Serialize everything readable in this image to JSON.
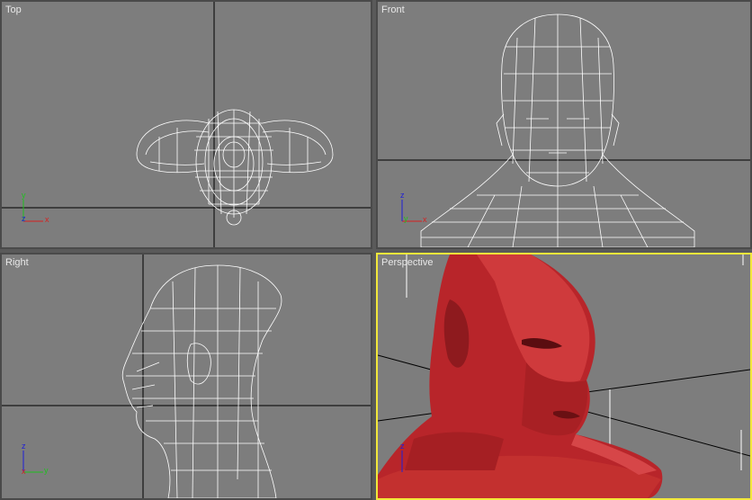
{
  "viewports": {
    "top": {
      "label": "Top"
    },
    "front": {
      "label": "Front"
    },
    "right": {
      "label": "Right"
    },
    "perspective": {
      "label": "Perspective"
    }
  },
  "axes": {
    "x": "x",
    "y": "y",
    "z": "z"
  },
  "colors": {
    "viewport_bg": "#7d7d7d",
    "active_border": "#f2e83a",
    "wire": "#ffffff",
    "mesh_red": "#c0282a",
    "axis_x": "#d62020",
    "axis_y": "#20c020",
    "axis_z": "#2020d6"
  }
}
